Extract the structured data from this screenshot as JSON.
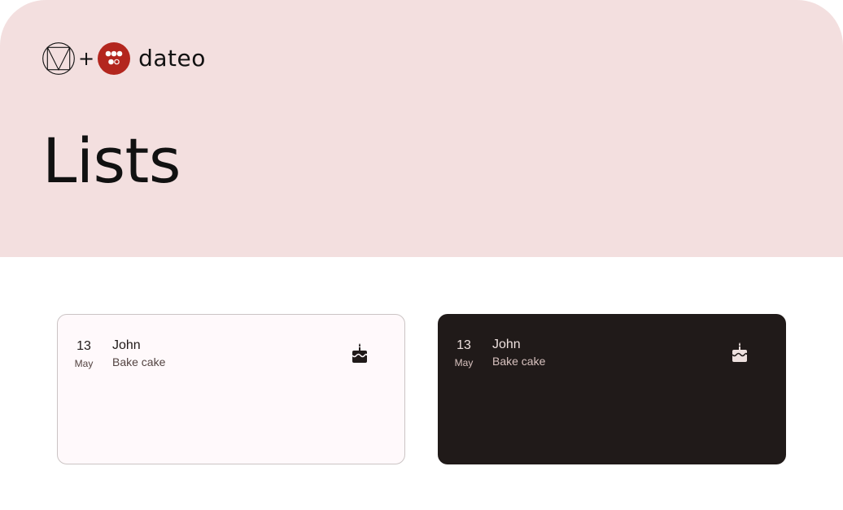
{
  "brand": {
    "material_logo_icon": "material-design-logo",
    "plus": "+",
    "dateo_logo_icon": "dateo-logo",
    "dateo_word": "dateo",
    "accent_color": "#b3261e"
  },
  "page": {
    "title": "Lists"
  },
  "colors": {
    "hero_background": "#f3dfdf",
    "light_card": "#fff9fb",
    "dark_card": "#201a19"
  },
  "cards": [
    {
      "theme": "light",
      "day": "13",
      "month": "May",
      "name": "John",
      "subtitle": "Bake cake",
      "icon": "cake-icon"
    },
    {
      "theme": "dark",
      "day": "13",
      "month": "May",
      "name": "John",
      "subtitle": "Bake cake",
      "icon": "cake-icon"
    }
  ]
}
